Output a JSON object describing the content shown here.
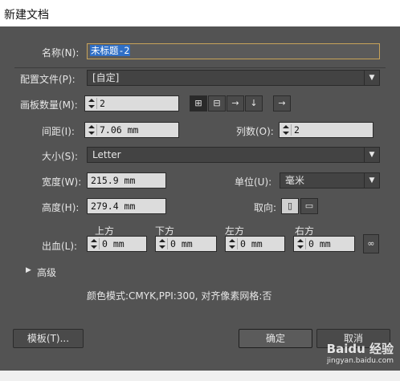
{
  "window": {
    "title": "新建文档"
  },
  "name": {
    "label": "名称(N):",
    "value": "未标题-2"
  },
  "profile": {
    "label": "配置文件(P):",
    "value": "[自定]"
  },
  "artboards": {
    "count_label": "画板数量(M):",
    "count_value": "2",
    "layout_icons": [
      "grid-by-row-icon",
      "grid-by-column-icon",
      "arrange-by-row-icon",
      "arrange-by-column-icon"
    ],
    "direction_icon": "right-to-left-arrow-icon",
    "spacing_label": "间距(I):",
    "spacing_value": "7.06 mm",
    "columns_label": "列数(O):",
    "columns_value": "2"
  },
  "size": {
    "label": "大小(S):",
    "value": "Letter"
  },
  "width": {
    "label": "宽度(W):",
    "value": "215.9 mm"
  },
  "units": {
    "label": "单位(U):",
    "value": "毫米"
  },
  "height": {
    "label": "高度(H):",
    "value": "279.4 mm"
  },
  "orientation": {
    "label": "取向:",
    "portrait_icon": "portrait-icon",
    "landscape_icon": "landscape-icon"
  },
  "bleed": {
    "label": "出血(L):",
    "top_label": "上方",
    "top_value": "0 mm",
    "bottom_label": "下方",
    "bottom_value": "0 mm",
    "left_label": "左方",
    "left_value": "0 mm",
    "right_label": "右方",
    "right_value": "0 mm",
    "link_icon": "link-icon"
  },
  "advanced": {
    "label": "高级",
    "toggle_icon": "triangle-right-icon"
  },
  "info": {
    "text": "颜色模式:CMYK,PPI:300, 对齐像素网格:否"
  },
  "buttons": {
    "templates": "模板(T)...",
    "ok": "确定",
    "cancel": "取消"
  },
  "watermark": {
    "brand": "Baidu 经验",
    "url": "jingyan.baidu.com"
  },
  "colors": {
    "panel": "#535353",
    "field": "#dcdcdc",
    "selection": "#2f6fc6",
    "focus_border": "#c8a35a"
  }
}
